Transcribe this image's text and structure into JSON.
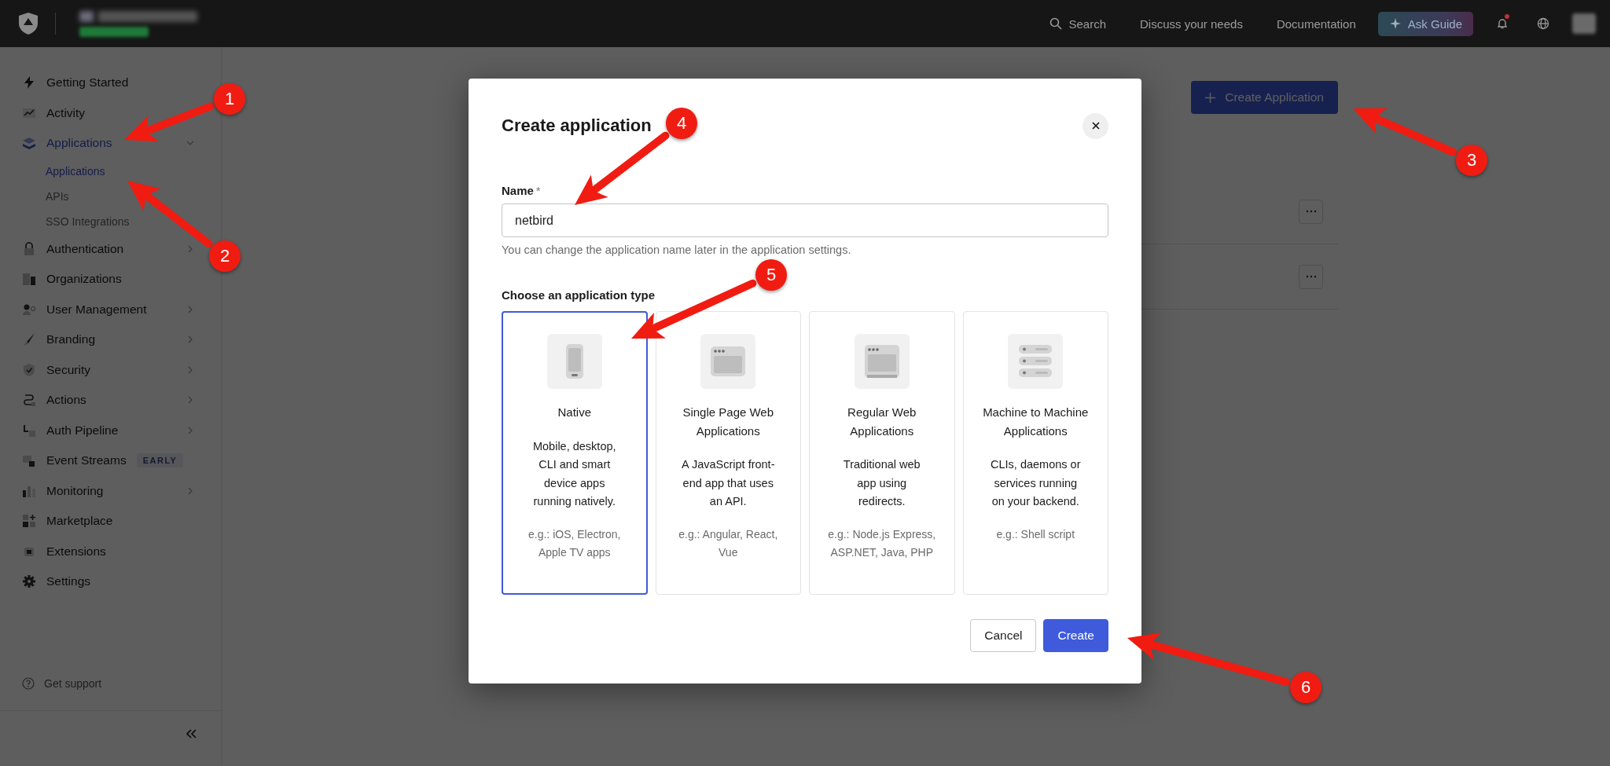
{
  "topbar": {
    "nav": [
      {
        "label": "Search",
        "kind": "search"
      },
      {
        "label": "Discuss your needs",
        "kind": "link"
      },
      {
        "label": "Documentation",
        "kind": "link"
      }
    ],
    "guide_button": "Ask Guide",
    "notification_unread": true
  },
  "sidebar": {
    "items": [
      {
        "label": "Getting Started",
        "selected": false
      },
      {
        "label": "Activity",
        "selected": false
      },
      {
        "label": "Applications",
        "selected": true,
        "expanded": true,
        "children": [
          {
            "label": "Applications",
            "selected": true
          },
          {
            "label": "APIs",
            "selected": false
          },
          {
            "label": "SSO Integrations",
            "selected": false
          }
        ]
      },
      {
        "label": "Authentication",
        "selected": false,
        "expanded": false
      },
      {
        "label": "Organizations",
        "selected": false
      },
      {
        "label": "User Management",
        "selected": false,
        "expanded": false
      },
      {
        "label": "Branding",
        "selected": false,
        "expanded": false
      },
      {
        "label": "Security",
        "selected": false,
        "expanded": false
      },
      {
        "label": "Actions",
        "selected": false,
        "expanded": false
      },
      {
        "label": "Auth Pipeline",
        "selected": false,
        "expanded": false
      },
      {
        "label": "Event Streams",
        "selected": false,
        "badge": "EARLY"
      },
      {
        "label": "Monitoring",
        "selected": false,
        "expanded": false
      },
      {
        "label": "Marketplace",
        "selected": false
      },
      {
        "label": "Extensions",
        "selected": false
      },
      {
        "label": "Settings",
        "selected": false
      }
    ],
    "support": "Get support"
  },
  "page": {
    "create_button": "Create Application",
    "rows": [
      {
        "kind": "application"
      },
      {
        "kind": "application"
      }
    ]
  },
  "dialog": {
    "title": "Create application",
    "name_field": {
      "label": "Name",
      "required_mark": "*",
      "value": "netbird",
      "hint": "You can change the application name later in the application settings."
    },
    "type_heading": "Choose an application type",
    "types": [
      {
        "kind": "native",
        "title": "Native",
        "description": "Mobile, desktop, CLI and smart device apps running natively.",
        "examples": "e.g.: iOS, Electron, Apple TV apps",
        "selected": true
      },
      {
        "kind": "spa",
        "title": "Single Page Web Applications",
        "description": "A JavaScript front-end app that uses an API.",
        "examples": "e.g.: Angular, React, Vue",
        "selected": false
      },
      {
        "kind": "regular",
        "title": "Regular Web Applications",
        "description": "Traditional web app using redirects.",
        "examples": "e.g.: Node.js Express, ASP.NET, Java, PHP",
        "selected": false
      },
      {
        "kind": "m2m",
        "title": "Machine to Machine Applications",
        "description": "CLIs, daemons or services running on your backend.",
        "examples": "e.g.: Shell script",
        "selected": false
      }
    ],
    "buttons": [
      {
        "label": "Cancel",
        "kind": "secondary"
      },
      {
        "label": "Create",
        "kind": "primary"
      }
    ]
  },
  "annotations": [
    {
      "number": "1"
    },
    {
      "number": "2"
    },
    {
      "number": "3"
    },
    {
      "number": "4"
    },
    {
      "number": "5"
    },
    {
      "number": "6"
    }
  ]
}
